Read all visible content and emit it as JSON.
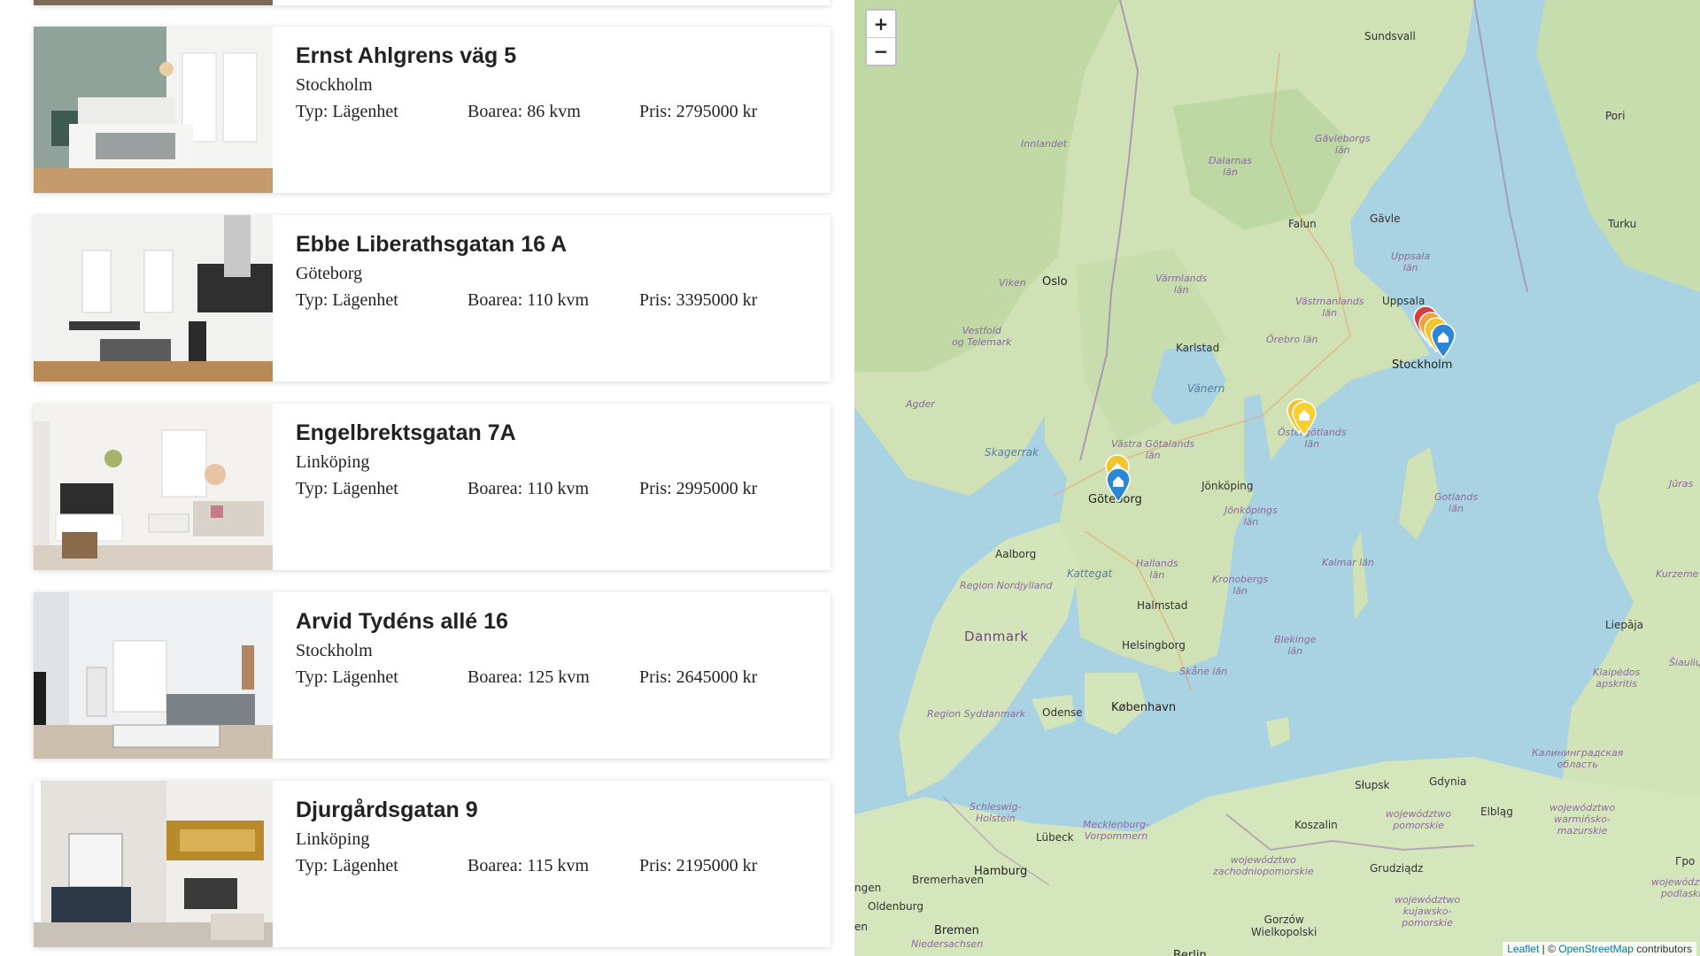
{
  "listings": [
    {
      "title": "Ernst Ahlgrens väg 5",
      "city": "Stockholm",
      "type": "Typ: Lägenhet",
      "area": "Boarea: 86 kvm",
      "price": "Pris: 2795000 kr"
    },
    {
      "title": "Ebbe Liberathsgatan 16 A",
      "city": "Göteborg",
      "type": "Typ: Lägenhet",
      "area": "Boarea: 110 kvm",
      "price": "Pris: 3395000 kr"
    },
    {
      "title": "Engelbrektsgatan 7A",
      "city": "Linköping",
      "type": "Typ: Lägenhet",
      "area": "Boarea: 110 kvm",
      "price": "Pris: 2995000 kr"
    },
    {
      "title": "Arvid Tydéns allé 16",
      "city": "Stockholm",
      "type": "Typ: Lägenhet",
      "area": "Boarea: 125 kvm",
      "price": "Pris: 2645000 kr"
    },
    {
      "title": "Djurgårdsgatan 9",
      "city": "Linköping",
      "type": "Typ: Lägenhet",
      "area": "Boarea: 115 kvm",
      "price": "Pris: 2195000 kr"
    }
  ],
  "map": {
    "zoom_in": "+",
    "zoom_out": "−",
    "attribution": {
      "leaflet": "Leaflet",
      "sep": " | © ",
      "osm": "OpenStreetMap",
      "suffix": " contributors"
    },
    "labels": {
      "sundsvall": "Sundsvall",
      "pori": "Pori",
      "turku": "Turku",
      "gavleborg": "Gävleborgs\nlän",
      "gavle": "Gävle",
      "falun": "Falun",
      "dalarnas": "Dalarnas\nlän",
      "innlandet": "Innlandet",
      "uppsala_lan": "Uppsala\nlän",
      "uppsala": "Uppsala",
      "vastmanlands": "Västmanlands\nlän",
      "oslo": "Oslo",
      "viken": "Viken",
      "varmlands": "Värmlands\nlän",
      "karlstad": "Karlstad",
      "orebro": "Örebro län",
      "stockholm": "Stockholm",
      "vestfold": "Vestfold\nog Telemark",
      "agder": "Agder",
      "vanern": "Vänern",
      "ostergotlands": "Östergötlands\nlän",
      "skagerrak": "Skagerrak",
      "vastra_gotalands": "Västra Götalands\nlän",
      "goteborg": "Göteborg",
      "jonkoping": "Jönköping",
      "jonkopings": "Jönköpings\nlän",
      "gotlands": "Gotlands\nlän",
      "aalborg": "Aalborg",
      "region_nord": "Region Nordjylland",
      "kattegat": "Kattegat",
      "hallands": "Hallands\nlän",
      "kronobergs": "Kronobergs\nlän",
      "kalmar": "Kalmar län",
      "kurzeme": "Kurzeme",
      "halmstad": "Halmstad",
      "danmark": "Danmark",
      "helsingborg": "Helsingborg",
      "blekinge": "Blekinge\nlän",
      "liepaja": "Liepāja",
      "skane": "Skåne län",
      "region_syd": "Region Syddanmark",
      "odense": "Odense",
      "kobenhavn": "København",
      "klaipeda": "Klaipėdos\napskritis",
      "kalin": "Калининградская\nобласть",
      "slupsk": "Słupsk",
      "gdynia": "Gdynia",
      "elblag": "Elbląg",
      "pomorskie": "województwo\npomorskie",
      "koszalin": "Koszalin",
      "warminsko": "województwo\nwarmińsko-\nmazurskie",
      "schleswig": "Schleswig-\nHolstein",
      "lubeck": "Lübeck",
      "mecklenburg": "Mecklenburg-\nVorpommern",
      "hamburg": "Hamburg",
      "zachodnio": "województwo\nzachodniopomorskie",
      "grudziadz": "Grudziądz",
      "bremerhaven": "Bremerhaven",
      "oldenburg": "Oldenburg",
      "bremen": "Bremen",
      "niedersachsen": "Niedersachsen",
      "gorzow": "Gorzów\nWielkopolski",
      "kujawsko": "województwo\nkujawsko-\npomorskie",
      "berlin": "Berlin",
      "ngen": "ngen",
      "en": "en",
      "siauliu": "Šiaulių",
      "jurmala": "Jūras",
      "gro": "Гро",
      "podlaskie": "województwo\npodlaskie"
    }
  }
}
